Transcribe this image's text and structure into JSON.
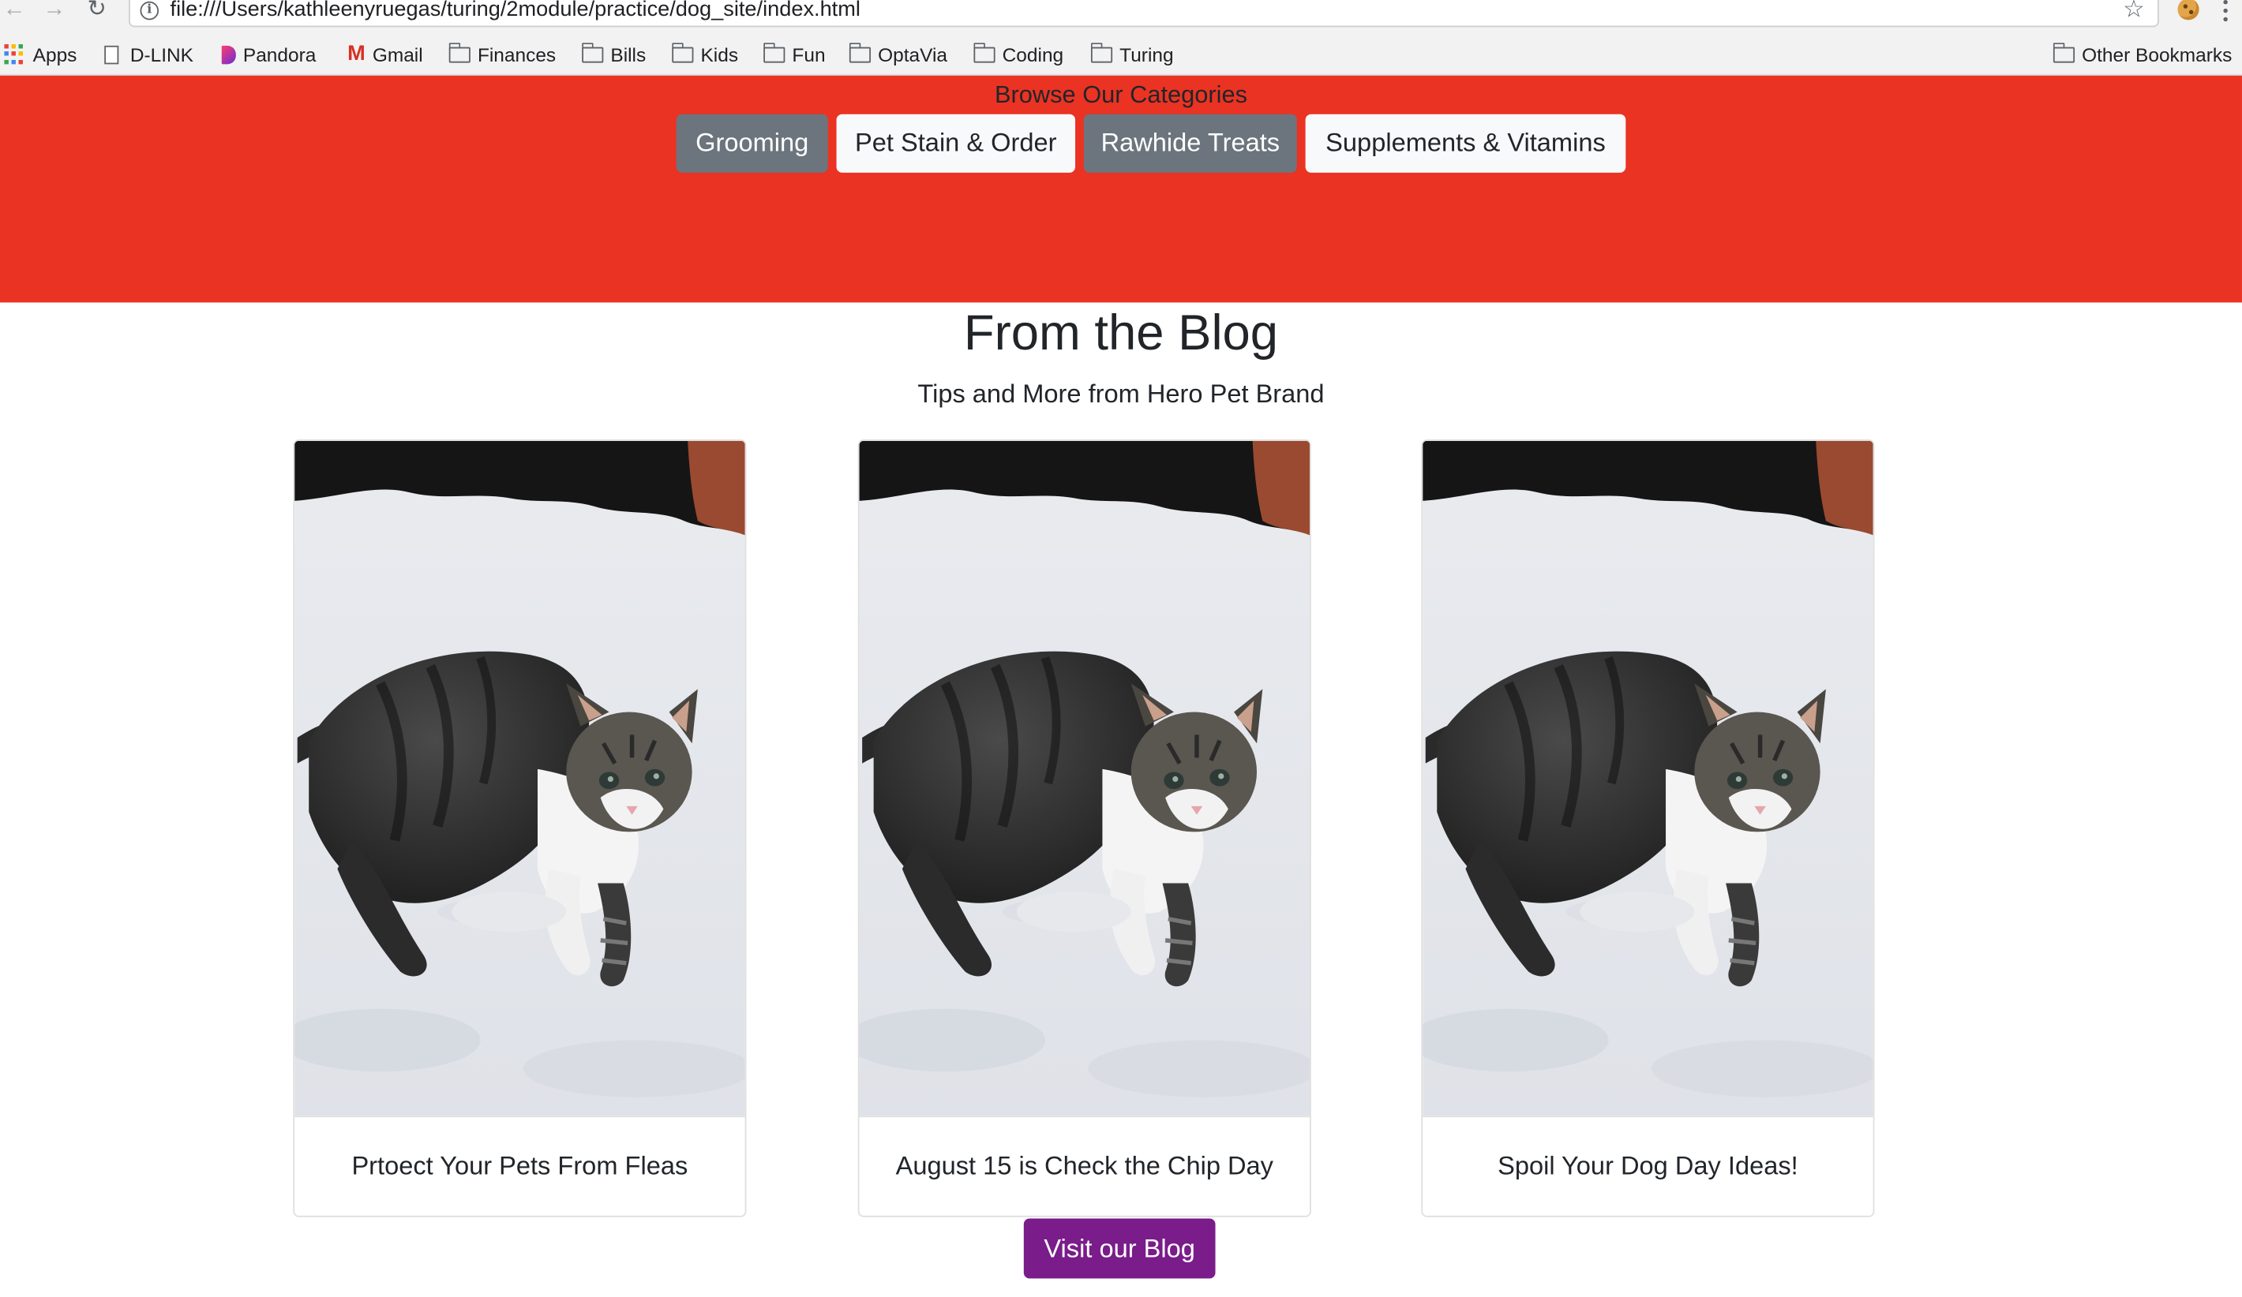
{
  "browser": {
    "url": "file:///Users/kathleenyruegas/turing/2module/practice/dog_site/index.html",
    "info_glyph": "i",
    "icons": {
      "back": "back-arrow-icon",
      "forward": "forward-arrow-icon",
      "reload": "reload-icon",
      "bookmark": "star-icon",
      "extension": "cookie-icon",
      "menu": "vertical-dots-icon"
    },
    "bookmarks": [
      {
        "label": "Apps",
        "icon": "apps-grid-icon"
      },
      {
        "label": "D-LINK",
        "icon": "page-icon"
      },
      {
        "label": "Pandora",
        "icon": "pandora-icon"
      },
      {
        "label": "Gmail",
        "icon": "gmail-icon"
      },
      {
        "label": "Finances",
        "icon": "folder-icon"
      },
      {
        "label": "Bills",
        "icon": "folder-icon"
      },
      {
        "label": "Kids",
        "icon": "folder-icon"
      },
      {
        "label": "Fun",
        "icon": "folder-icon"
      },
      {
        "label": "OptaVia",
        "icon": "folder-icon"
      },
      {
        "label": "Coding",
        "icon": "folder-icon"
      },
      {
        "label": "Turing",
        "icon": "folder-icon"
      }
    ],
    "other_bookmarks": "Other Bookmarks"
  },
  "hero": {
    "heading": "Browse Our Categories",
    "background_color": "#ea3323",
    "categories": [
      {
        "label": "Grooming",
        "style": "secondary"
      },
      {
        "label": "Pet Stain & Order",
        "style": "light"
      },
      {
        "label": "Rawhide Treats",
        "style": "secondary"
      },
      {
        "label": "Supplements & Vitamins",
        "style": "light"
      }
    ]
  },
  "blog": {
    "title": "From the Blog",
    "subtitle": "Tips and More from Hero Pet Brand",
    "cards": [
      {
        "caption": "Prtoect Your Pets From Fleas",
        "image": "kitten-in-snow-photo"
      },
      {
        "caption": "August 15 is Check the Chip Day",
        "image": "kitten-in-snow-photo"
      },
      {
        "caption": "Spoil Your Dog Day Ideas!",
        "image": "kitten-in-snow-photo"
      }
    ],
    "cta": "Visit our Blog",
    "cta_color": "#7a1c8a"
  }
}
